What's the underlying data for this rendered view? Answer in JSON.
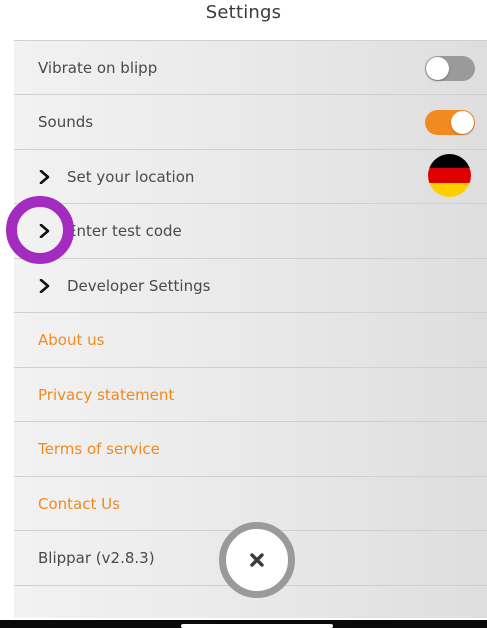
{
  "header": {
    "title": "Settings"
  },
  "settings": {
    "vibrate": {
      "label": "Vibrate on blipp",
      "enabled": false
    },
    "sounds": {
      "label": "Sounds",
      "enabled": true
    },
    "location": {
      "label": "Set your location",
      "flag": "germany-flag-icon"
    },
    "test_code": {
      "label": "Enter test code"
    },
    "developer": {
      "label": "Developer Settings"
    }
  },
  "links": {
    "about": "About us",
    "privacy": "Privacy statement",
    "terms": "Terms of service",
    "contact": "Contact Us"
  },
  "footer": {
    "version": "Blippar (v2.8.3)"
  },
  "colors": {
    "accent": "#f08a1f",
    "toggle_off": "#9a9a9a",
    "touch_indicator": "#a32bbf",
    "flag_stripes": [
      "#000000",
      "#dd0000",
      "#ffce00"
    ]
  }
}
